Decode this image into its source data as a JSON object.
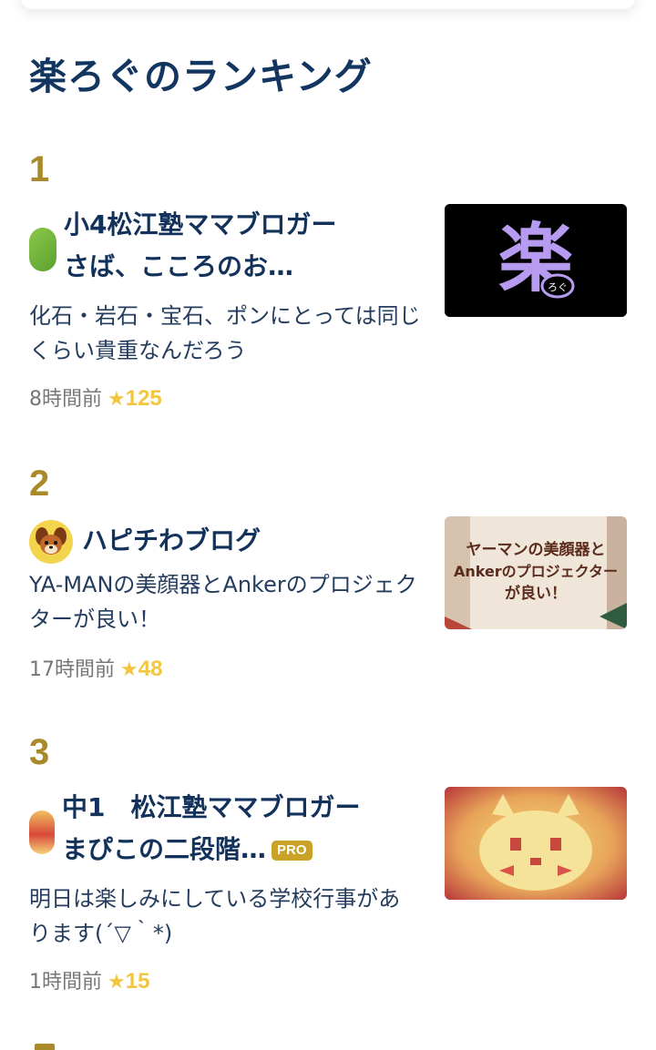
{
  "section": {
    "title": "楽ろぐのランキング"
  },
  "thumb_texts": {
    "item1": {
      "kanji": "楽",
      "small": "ろぐ"
    },
    "item2": {
      "line1": "ヤーマンの美顔器と",
      "line2": "Ankerのプロジェクター",
      "line3": "が良い！"
    }
  },
  "ranking": [
    {
      "rank": "1",
      "title_line1": "小4松江塾ママブロガー",
      "title_line2": "さば、こころのお…",
      "text": "化石・岩石・宝石、ポンにとっては同じくらい貴重なんだろう",
      "time": "8時間前",
      "likes": "125"
    },
    {
      "rank": "2",
      "title_line1": "ハピチわブログ",
      "text": "YA-MANの美顔器とAnkerのプロジェクターが良い！",
      "time": "17時間前",
      "likes": "48"
    },
    {
      "rank": "3",
      "title_line1": "中1　松江塾ママブロガー",
      "title_line2": "まぴこの二段階…",
      "badge": "PRO",
      "text": "明日は楽しみにしている学校行事があります(´▽｀*)",
      "time": "1時間前",
      "likes": "15"
    }
  ],
  "colors": {
    "rank": "#a88a2a",
    "title": "#133660",
    "star": "#f2c640",
    "pro": "#c9a227"
  },
  "icons": {
    "star": "star-icon"
  }
}
